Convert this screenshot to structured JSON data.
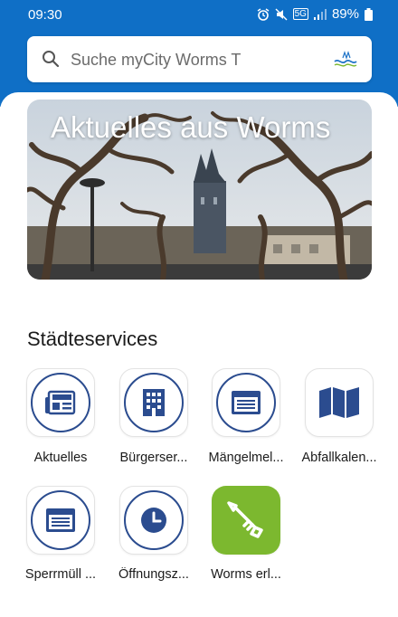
{
  "status": {
    "time": "09:30",
    "battery": "89%",
    "network": "5G"
  },
  "search": {
    "placeholder": "Suche myCity Worms T",
    "icon": "search-icon",
    "logo": "worms-logo"
  },
  "hero": {
    "title": "Aktuelles aus Worms"
  },
  "services": {
    "title": "Städteservices",
    "items": [
      {
        "label": "Aktuelles",
        "icon": "newspaper-icon"
      },
      {
        "label": "Bürgerser...",
        "icon": "building-icon"
      },
      {
        "label": "Mängelmel...",
        "icon": "form-icon"
      },
      {
        "label": "Abfallkalen...",
        "icon": "map-icon"
      },
      {
        "label": "Sperrmüll ...",
        "icon": "form-icon"
      },
      {
        "label": "Öffnungsz...",
        "icon": "clock-icon"
      },
      {
        "label": "Worms erl...",
        "icon": "key-icon"
      }
    ]
  },
  "colors": {
    "header": "#0f6fc6",
    "icon_navy": "#2b4c8f",
    "green_tile": "#7cb82f"
  }
}
